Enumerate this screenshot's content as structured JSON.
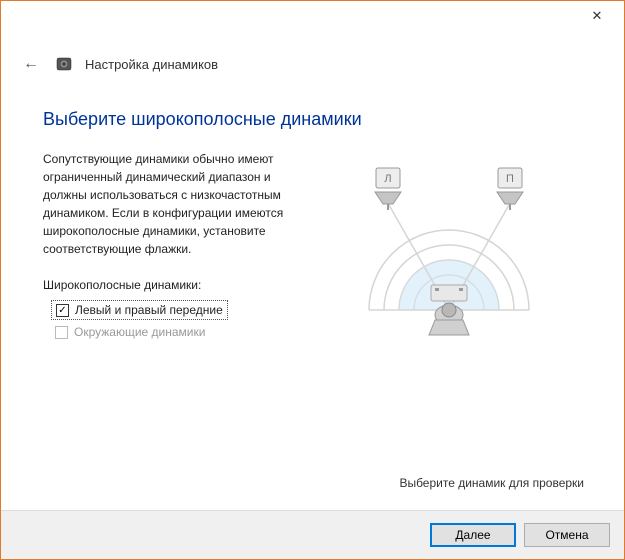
{
  "header": {
    "title": "Настройка динамиков"
  },
  "main": {
    "heading": "Выберите широкополосные динамики",
    "description": "Сопутствующие динамики обычно имеют ограниченный динамический диапазон и должны использоваться с низкочастотным динамиком.  Если в конфигурации имеются широкополосные динамики, установите соответствующие флажки.",
    "sectionLabel": "Широкополосные динамики:",
    "options": [
      {
        "label": "Левый и правый передние",
        "checked": true,
        "enabled": true
      },
      {
        "label": "Окружающие динамики",
        "checked": false,
        "enabled": false
      }
    ],
    "diagram": {
      "leftLabel": "Л",
      "rightLabel": "П"
    },
    "hint": "Выберите динамик для проверки"
  },
  "footer": {
    "next": "Далее",
    "cancel": "Отмена"
  }
}
